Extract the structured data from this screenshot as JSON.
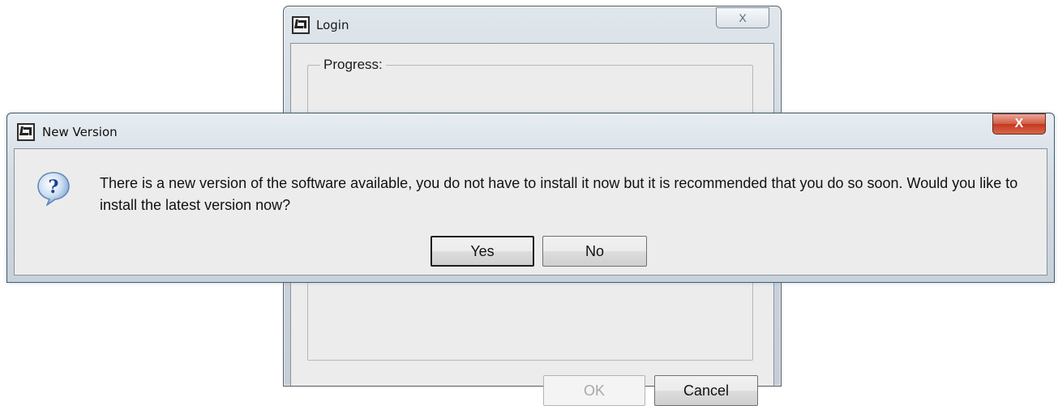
{
  "login": {
    "title": "Login",
    "close_glyph": "X",
    "title_icon": "app-logo-icon",
    "group_label": "Progress:",
    "ok_label": "OK",
    "cancel_label": "Cancel"
  },
  "new_version": {
    "title": "New Version",
    "close_glyph": "X",
    "title_icon": "app-logo-icon",
    "message_icon": "question-icon",
    "message": "There is a new version of the software available, you do not have to install it now but it is recommended that you do so soon. Would you like to install the latest version now?",
    "yes_label": "Yes",
    "no_label": "No"
  }
}
